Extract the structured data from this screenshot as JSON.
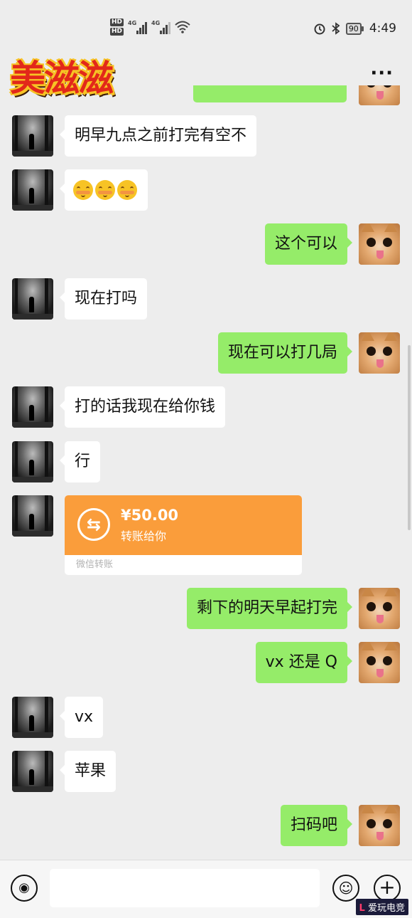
{
  "status_bar": {
    "hd1": "HD",
    "hd2": "HD",
    "net1": "4G",
    "net2": "4G",
    "battery": "90",
    "time": "4:49"
  },
  "header": {
    "title": "美滋滋",
    "more_icon": "more-dots-icon"
  },
  "messages": [
    {
      "side": "left",
      "text": "明早九点之前打完有空不"
    },
    {
      "side": "left",
      "emoji_count": 3,
      "emoji": "blush-face"
    },
    {
      "side": "right",
      "text": "这个可以"
    },
    {
      "side": "left",
      "text": "现在打吗"
    },
    {
      "side": "right",
      "text": "现在可以打几局"
    },
    {
      "side": "left",
      "text": "打的话我现在给你钱"
    },
    {
      "side": "left",
      "text": "行"
    },
    {
      "side": "left",
      "transfer": {
        "amount": "¥50.00",
        "desc": "转账给你",
        "footer": "微信转账"
      }
    },
    {
      "side": "right",
      "text": "剩下的明天早起打完"
    },
    {
      "side": "right",
      "text": "vx 还是 Q"
    },
    {
      "side": "left",
      "text": "vx"
    },
    {
      "side": "left",
      "text": "苹果"
    },
    {
      "side": "right",
      "text": "扫码吧"
    }
  ],
  "input_bar": {
    "voice_icon": "voice-icon",
    "emoji_icon": "emoji-icon",
    "plus_icon": "plus-icon",
    "placeholder": ""
  },
  "watermark": {
    "brand_l": "L",
    "text": "爱玩",
    "text2": "电竞"
  }
}
